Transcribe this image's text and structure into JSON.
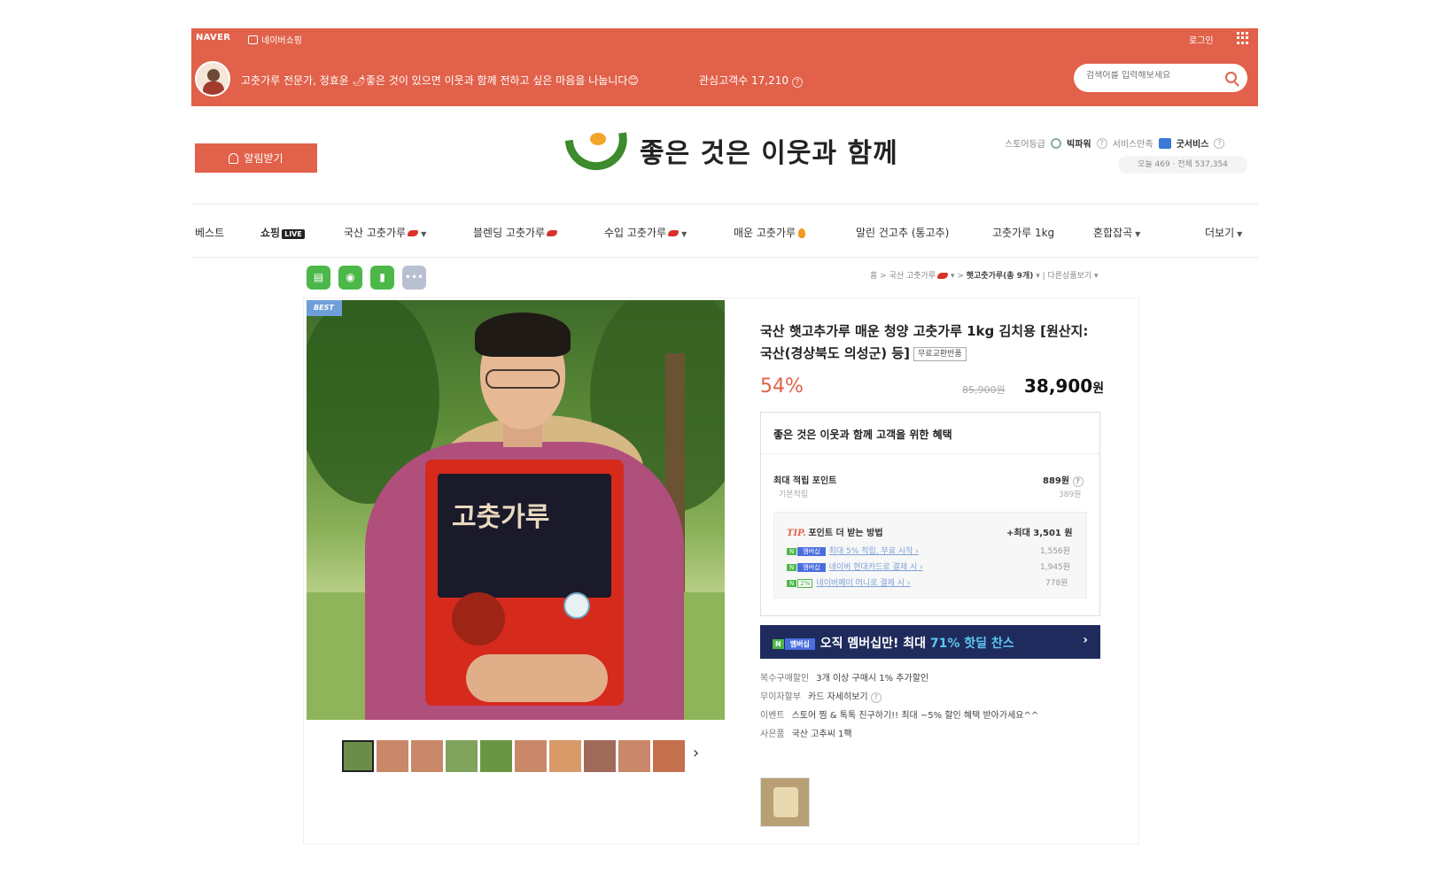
{
  "gnb": {
    "naver": "NAVER",
    "shopping": "네이버쇼핑",
    "login": "로그인"
  },
  "store": {
    "description": "고춧가루 전문가, 정효윤 🌶좋은 것이 있으면 이웃과 함께 전하고 싶은 마음을 나눕니다😊",
    "followers": "관심고객수 17,210",
    "search_placeholder": "검색어를 입력해보세요",
    "alarm_label": "알림받기",
    "brand_name": "좋은 것은 이웃과 함께",
    "grade_label": "스토어등급",
    "grade_value": "빅파워",
    "service_label": "서비스만족",
    "service_value": "굿서비스",
    "visits": "오늘 469 · 전체 537,354"
  },
  "nav": {
    "items": [
      {
        "label": "베스트"
      },
      {
        "label": "쇼핑",
        "badge": "LIVE"
      },
      {
        "label": "국산 고춧가루"
      },
      {
        "label": "블렌딩 고춧가루"
      },
      {
        "label": "수입 고춧가루"
      },
      {
        "label": "매운 고춧가루"
      },
      {
        "label": "말린 건고추 (통고추)"
      },
      {
        "label": "고춧가루 1kg"
      },
      {
        "label": "혼합잡곡"
      },
      {
        "label": "더보기"
      }
    ]
  },
  "breadcrumb": {
    "home": "홈",
    "cat1": "국산 고춧가루",
    "cat2": "햇고춧가루(총 9개)",
    "other": "다른상품보기"
  },
  "product": {
    "best_tag": "BEST",
    "title": "국산 햇고추가루 매운 청양 고춧가루 1kg 김치용 [원산지:국산(경상북도 의성군) 등]",
    "free_tag": "무료교환반품",
    "discount": "54%",
    "original_price": "85,900원",
    "sale_price": "38,900",
    "sale_unit": "원",
    "bag_text": "고춧가루"
  },
  "benefit": {
    "title": "좋은 것은 이웃과 함께 고객을 위한 혜택",
    "point_label": "최대 적립 포인트",
    "point_value": "889원",
    "basic_label": "기본적립",
    "basic_value": "389원",
    "tip_em": "TIP.",
    "tip_title": "포인트 더 받는 방법",
    "tip_max": "+최대 3,501 원",
    "tips": [
      {
        "label": "최대 5% 적립, 무료 시작",
        "value": "1,556원",
        "badge": "멤버십"
      },
      {
        "label": "네이버 현대카드로 결제 시",
        "value": "1,945원",
        "badge": "멤버십"
      },
      {
        "label": "네이버페이 머니로 결제 시",
        "value": "778원",
        "badge": "2%"
      }
    ]
  },
  "membership": {
    "badge": "멤버십",
    "text": "오직 멤버십만! 최대 ",
    "highlight": "71% 핫딜 찬스"
  },
  "extras": [
    {
      "key": "복수구매할인",
      "value": "3개 이상 구매시 1% 추가할인"
    },
    {
      "key": "무이자할부",
      "value": "카드 자세히보기"
    },
    {
      "key": "이벤트",
      "value": "스토어 찜 & 톡톡 친구하기!! 최대 ~5% 할인 혜택 받아가세요^^"
    },
    {
      "key": "사은품",
      "value": "국산 고추씨 1팩"
    }
  ],
  "colors": {
    "brand_red": "#e1614a",
    "brand_green": "#3c8b2c",
    "membership_navy": "#1e2b5c"
  }
}
